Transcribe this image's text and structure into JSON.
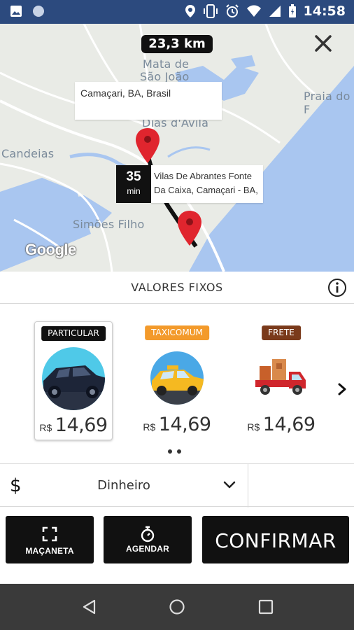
{
  "status_bar": {
    "time": "14:58",
    "left_icons": [
      "image-icon",
      "circle-icon"
    ],
    "right_icons": [
      "location-icon",
      "vibrate-icon",
      "alarm-icon",
      "wifi-icon",
      "signal-icon",
      "battery-icon"
    ]
  },
  "map": {
    "distance": "23,3 km",
    "labels": {
      "mata": "Mata de",
      "sao_joao": "São João",
      "dias": "Dias d'Avila",
      "candeias": "Candeias",
      "simoes": "Simões Filho",
      "praia": "Praia do F"
    },
    "origin_address": "Camaçari, BA, Brasil",
    "eta_value": "35",
    "eta_unit": "min",
    "destination_address": "Vilas De Abrantes Fonte Da Caixa, Camaçari - BA,",
    "attribution": "Google",
    "colors": {
      "water": "#a9c6f0",
      "land": "#e9ebe6",
      "road": "#ffffff",
      "pin": "#e0252e"
    }
  },
  "header": {
    "title": "VALORES FIXOS"
  },
  "categories": [
    {
      "tag": "PARTICULAR",
      "currency": "R$",
      "price": "14,69",
      "selected": true
    },
    {
      "tag": "TAXICOMUM",
      "currency": "R$",
      "price": "14,69",
      "selected": false
    },
    {
      "tag": "FRETE",
      "currency": "R$",
      "price": "14,69",
      "selected": false
    }
  ],
  "payment": {
    "icon": "$",
    "method": "Dinheiro"
  },
  "buttons": {
    "maçaneta": "MAÇANETA",
    "agendar": "AGENDAR",
    "confirmar": "CONFIRMAR"
  }
}
